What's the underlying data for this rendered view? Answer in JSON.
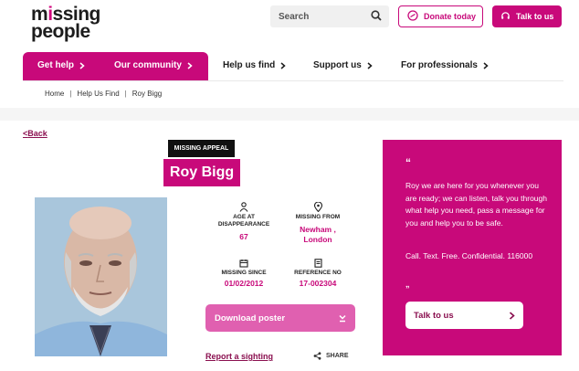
{
  "header": {
    "logo": {
      "line1_pre": "m",
      "line1_accent": "i",
      "line1_post": "ssing",
      "line2": "people"
    },
    "search_placeholder": "Search",
    "donate_label": "Donate today",
    "talk_label": "Talk to us"
  },
  "nav": {
    "items": [
      {
        "label": "Get help",
        "active": true
      },
      {
        "label": "Our community",
        "active": true
      },
      {
        "label": "Help us find",
        "active": false
      },
      {
        "label": "Support us",
        "active": false
      },
      {
        "label": "For professionals",
        "active": false
      }
    ]
  },
  "breadcrumbs": [
    "Home",
    "Help Us Find",
    "Roy Bigg"
  ],
  "back_label": "Back",
  "appeal": {
    "tag": "MISSING APPEAL",
    "name": "Roy Bigg",
    "age_label": "AGE AT DISAPPEARANCE",
    "age_value": "67",
    "from_label": "MISSING FROM",
    "from_value_line1": "Newham ,",
    "from_value_line2": "London",
    "since_label": "MISSING SINCE",
    "since_value": "01/02/2012",
    "ref_label": "REFERENCE NO",
    "ref_value": "17-002304",
    "download_label": "Download poster",
    "sighting_label": "Report a sighting",
    "share_label": "SHARE"
  },
  "panel": {
    "open_quote": "“",
    "message": "Roy we are here for you whenever you are ready; we can listen, talk you through what help you need, pass a message for you and help you to be safe.",
    "contact": "Call. Text. Free. Confidential. 116000",
    "close_quote": "„",
    "talk_label": "Talk to us"
  },
  "colors": {
    "brand": "#c8097a",
    "dark_brand": "#8a0f4f",
    "button_light": "#e060b0"
  }
}
